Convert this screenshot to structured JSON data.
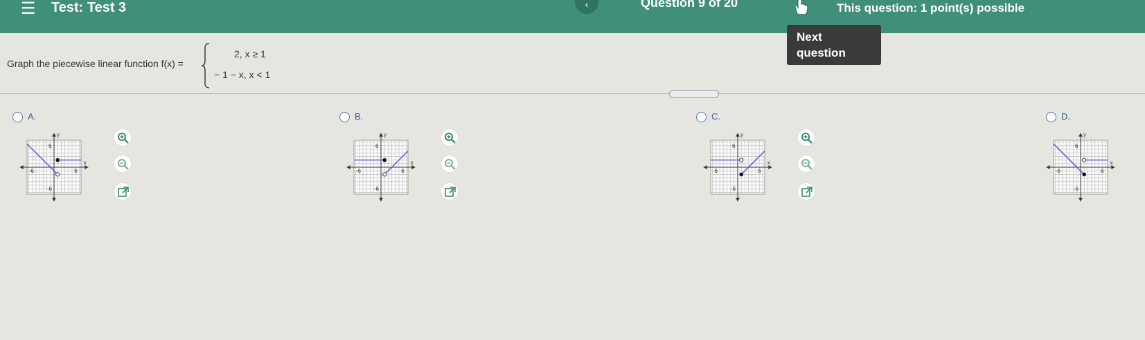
{
  "header": {
    "menu_icon": "hamburger-menu-icon",
    "title": "Test: Test 3",
    "prev_icon": "chevron-left-icon",
    "prev_glyph": "‹",
    "question_counter": "Question 9 of 20",
    "points": "This question: 1 point(s) possible",
    "tooltip": "Next question",
    "bar_color": "#3f8f7a"
  },
  "question": {
    "prompt": "Graph the piecewise linear function f(x) =",
    "case1": "2,  x ≥ 1",
    "case2": "− 1 − x,  x < 1"
  },
  "options": [
    {
      "label": "A.",
      "icons": [
        "zoom-in-icon",
        "zoom-out-icon",
        "open-new-window-icon"
      ]
    },
    {
      "label": "B.",
      "icons": [
        "zoom-in-icon",
        "zoom-out-icon",
        "open-new-window-icon"
      ]
    },
    {
      "label": "C.",
      "icons": [
        "zoom-in-icon",
        "zoom-out-icon",
        "open-new-window-icon"
      ]
    },
    {
      "label": "D."
    }
  ],
  "axes": {
    "x_label": "x",
    "y_label": "y",
    "min_tick": "-6",
    "max_tick": "6"
  },
  "colors": {
    "accent": "#4f78b4",
    "graph_line": "#5a4fd6",
    "grid": "#b8b8b8"
  }
}
